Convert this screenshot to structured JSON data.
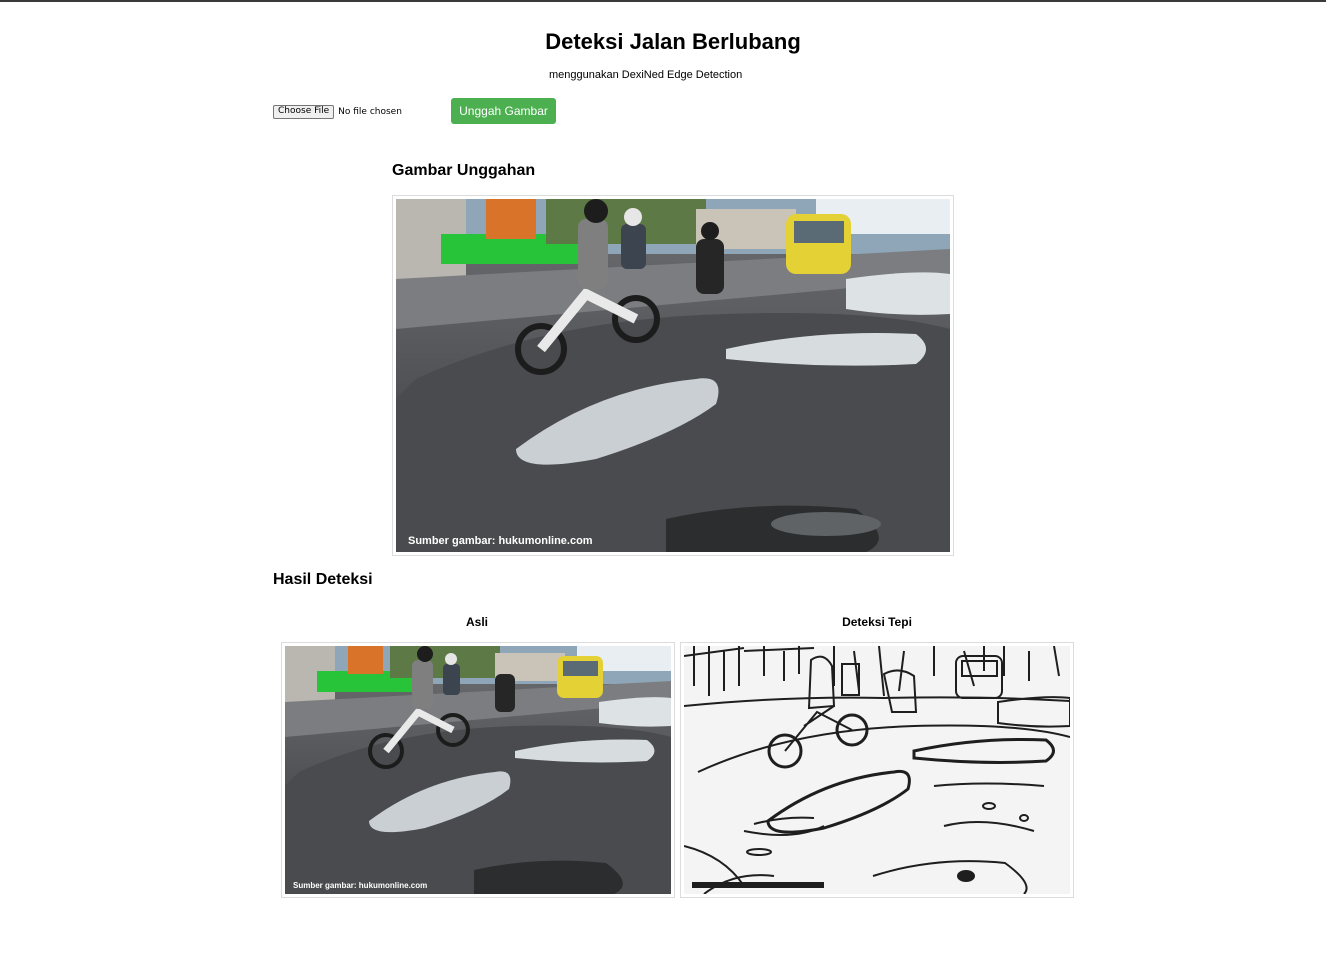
{
  "header": {
    "title": "Deteksi Jalan Berlubang",
    "subtitle": "menggunakan DexiNed Edge Detection"
  },
  "upload": {
    "choose_file_label": "Choose File",
    "file_status": "No file chosen",
    "submit_label": "Unggah Gambar"
  },
  "uploaded_section": {
    "title": "Gambar Unggahan",
    "image_credit": "Sumber gambar: hukumonline.com"
  },
  "result_section": {
    "title": "Hasil Deteksi",
    "columns": [
      {
        "label": "Asli",
        "image_credit": "Sumber gambar: hukumonline.com"
      },
      {
        "label": "Deteksi Tepi"
      }
    ]
  },
  "colors": {
    "accent": "#4caf50",
    "topline": "#3a3a3a"
  }
}
